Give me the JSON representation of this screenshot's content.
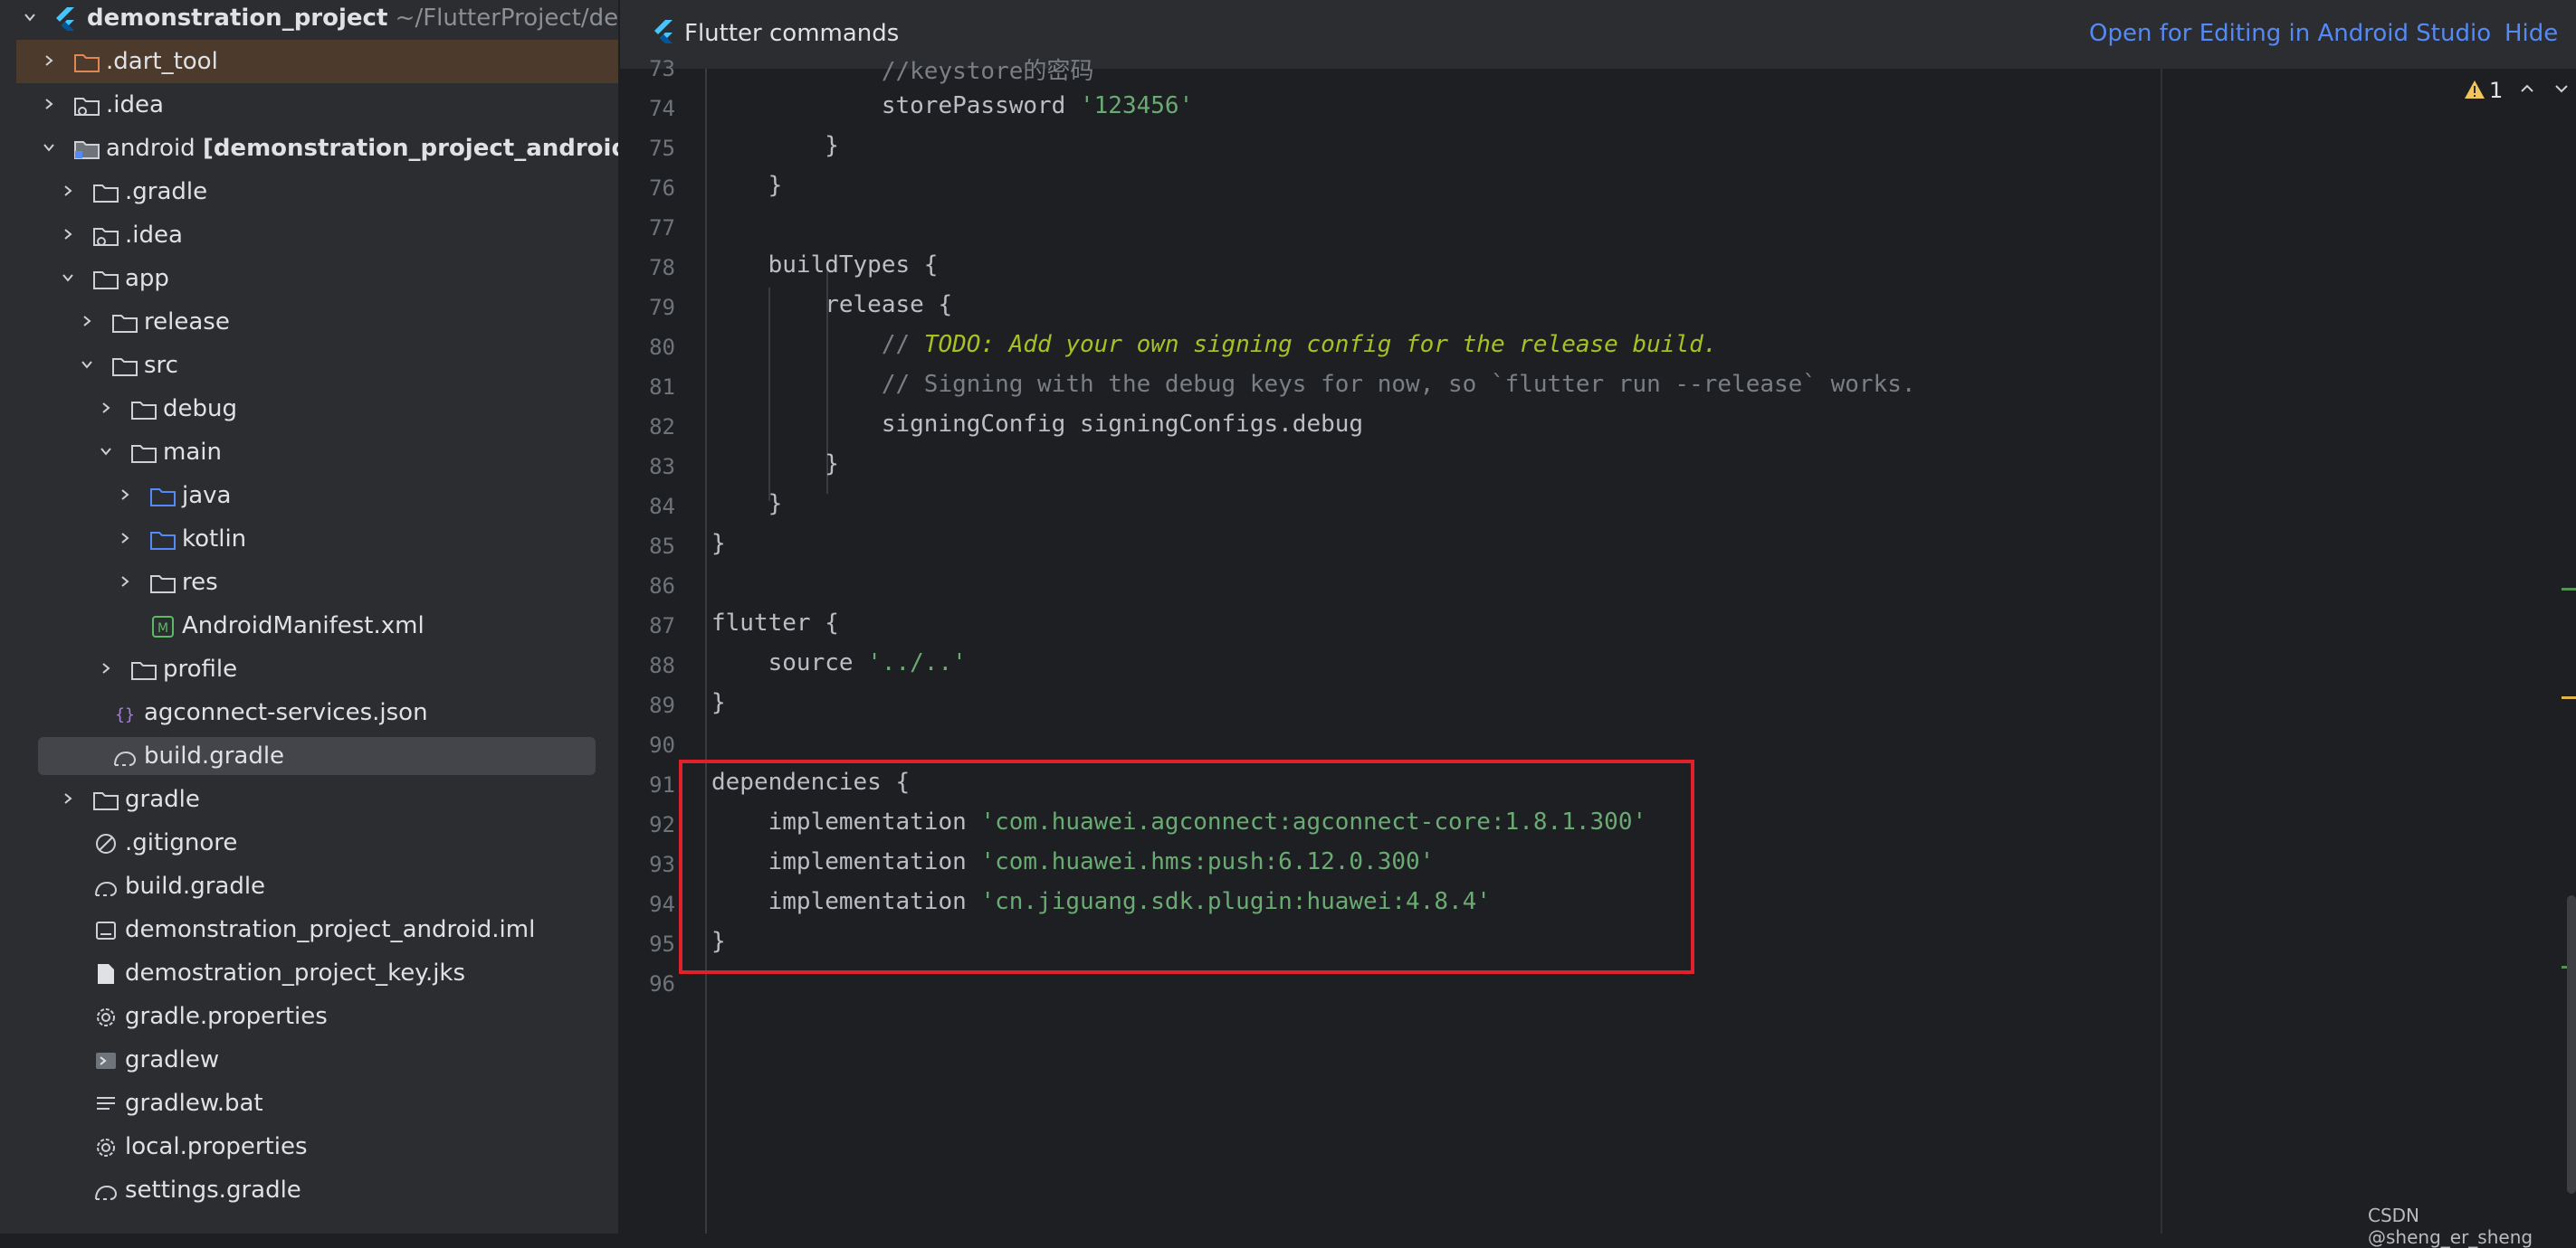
{
  "tree": {
    "items": [
      {
        "label": "demonstration_project",
        "sub": "~/FlutterProject/demo",
        "chev": "down",
        "icon": "flutter",
        "depth": 0,
        "bold": true
      },
      {
        "label": ".dart_tool",
        "chev": "right",
        "icon": "folder-excluded",
        "depth": 1,
        "highlight": true
      },
      {
        "label": ".idea",
        "chev": "right",
        "icon": "folder-settings",
        "depth": 1
      },
      {
        "label": "android",
        "sub": "[demonstration_project_android]",
        "chev": "down",
        "icon": "folder-module",
        "depth": 1
      },
      {
        "label": ".gradle",
        "chev": "right",
        "icon": "folder",
        "depth": 2
      },
      {
        "label": ".idea",
        "chev": "right",
        "icon": "folder-settings",
        "depth": 2
      },
      {
        "label": "app",
        "chev": "down",
        "icon": "folder",
        "depth": 2
      },
      {
        "label": "release",
        "chev": "right",
        "icon": "folder",
        "depth": 3
      },
      {
        "label": "src",
        "chev": "down",
        "icon": "folder",
        "depth": 3
      },
      {
        "label": "debug",
        "chev": "right",
        "icon": "folder",
        "depth": 4
      },
      {
        "label": "main",
        "chev": "down",
        "icon": "folder",
        "depth": 4
      },
      {
        "label": "java",
        "chev": "right",
        "icon": "folder-source",
        "depth": 5
      },
      {
        "label": "kotlin",
        "chev": "right",
        "icon": "folder-source",
        "depth": 5
      },
      {
        "label": "res",
        "chev": "right",
        "icon": "folder",
        "depth": 5
      },
      {
        "label": "AndroidManifest.xml",
        "chev": "none",
        "icon": "manifest",
        "depth": 5
      },
      {
        "label": "profile",
        "chev": "right",
        "icon": "folder",
        "depth": 4
      },
      {
        "label": "agconnect-services.json",
        "chev": "none",
        "icon": "json",
        "depth": 3
      },
      {
        "label": "build.gradle",
        "chev": "none",
        "icon": "gradle",
        "depth": 3,
        "selected": true
      },
      {
        "label": "gradle",
        "chev": "right",
        "icon": "folder",
        "depth": 2
      },
      {
        "label": ".gitignore",
        "chev": "none",
        "icon": "ignore",
        "depth": 2
      },
      {
        "label": "build.gradle",
        "chev": "none",
        "icon": "gradle",
        "depth": 2
      },
      {
        "label": "demonstration_project_android.iml",
        "chev": "none",
        "icon": "iml",
        "depth": 2
      },
      {
        "label": "demostration_project_key.jks",
        "chev": "none",
        "icon": "file",
        "depth": 2
      },
      {
        "label": "gradle.properties",
        "chev": "none",
        "icon": "gear",
        "depth": 2
      },
      {
        "label": "gradlew",
        "chev": "none",
        "icon": "terminal",
        "depth": 2
      },
      {
        "label": "gradlew.bat",
        "chev": "none",
        "icon": "text",
        "depth": 2
      },
      {
        "label": "local.properties",
        "chev": "none",
        "icon": "gear",
        "depth": 2
      },
      {
        "label": "settings.gradle",
        "chev": "none",
        "icon": "gradle",
        "depth": 2
      }
    ]
  },
  "banner": {
    "title": "Flutter commands",
    "open_link": "Open for Editing in Android Studio",
    "hide_link": "Hide"
  },
  "editor": {
    "warning_count": "1",
    "lines": [
      {
        "n": "73",
        "segs": [
          {
            "t": "            "
          },
          {
            "t": "//keystore的密码",
            "c": "cmt"
          }
        ]
      },
      {
        "n": "74",
        "segs": [
          {
            "t": "            storePassword "
          },
          {
            "t": "'123456'",
            "c": "str"
          }
        ]
      },
      {
        "n": "75",
        "segs": [
          {
            "t": "        }"
          }
        ]
      },
      {
        "n": "76",
        "segs": [
          {
            "t": "    }"
          }
        ]
      },
      {
        "n": "77",
        "segs": []
      },
      {
        "n": "78",
        "segs": [
          {
            "t": "    buildTypes {"
          }
        ]
      },
      {
        "n": "79",
        "segs": [
          {
            "t": "        release {"
          }
        ]
      },
      {
        "n": "80",
        "segs": [
          {
            "t": "            "
          },
          {
            "t": "// ",
            "c": "cmt"
          },
          {
            "t": "TODO: Add your own signing config for the release build.",
            "c": "todo"
          }
        ]
      },
      {
        "n": "81",
        "segs": [
          {
            "t": "            "
          },
          {
            "t": "// Signing with the debug keys for now, so `flutter run --release` works.",
            "c": "cmt"
          }
        ]
      },
      {
        "n": "82",
        "segs": [
          {
            "t": "            signingConfig signingConfigs.debug"
          }
        ]
      },
      {
        "n": "83",
        "segs": [
          {
            "t": "        }"
          }
        ]
      },
      {
        "n": "84",
        "segs": [
          {
            "t": "    }"
          }
        ]
      },
      {
        "n": "85",
        "segs": [
          {
            "t": "}"
          }
        ]
      },
      {
        "n": "86",
        "segs": []
      },
      {
        "n": "87",
        "segs": [
          {
            "t": "flutter {"
          }
        ]
      },
      {
        "n": "88",
        "segs": [
          {
            "t": "    source "
          },
          {
            "t": "'../..'",
            "c": "str"
          }
        ]
      },
      {
        "n": "89",
        "segs": [
          {
            "t": "}"
          }
        ]
      },
      {
        "n": "90",
        "segs": []
      },
      {
        "n": "91",
        "segs": [
          {
            "t": "dependencies {"
          }
        ]
      },
      {
        "n": "92",
        "segs": [
          {
            "t": "    implementation "
          },
          {
            "t": "'com.huawei.agconnect:agconnect-core:1.8.1.300'",
            "c": "str"
          }
        ]
      },
      {
        "n": "93",
        "segs": [
          {
            "t": "    implementation "
          },
          {
            "t": "'com.huawei.hms:push:6.12.0.300'",
            "c": "str"
          }
        ]
      },
      {
        "n": "94",
        "segs": [
          {
            "t": "    implementation "
          },
          {
            "t": "'cn.jiguang.sdk.plugin:huawei:4.8.4'",
            "c": "str"
          }
        ]
      },
      {
        "n": "95",
        "segs": [
          {
            "t": "}"
          }
        ]
      },
      {
        "n": "96",
        "segs": []
      }
    ]
  },
  "colors": {
    "accent": "#548af7",
    "string": "#6aab73",
    "comment": "#7a7e85",
    "todo": "#a8c023",
    "highlight_box": "#e0202a"
  },
  "watermark": "CSDN @sheng_er_sheng"
}
